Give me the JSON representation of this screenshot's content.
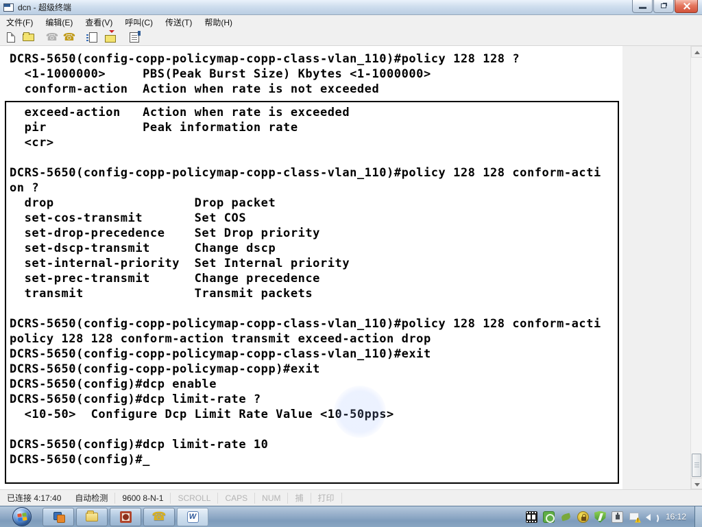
{
  "window": {
    "title": "dcn - 超级终端",
    "controls": {
      "minimize": "minimize",
      "restore": "restore",
      "close": "close"
    }
  },
  "menu": {
    "items": [
      {
        "label": "文件(F)"
      },
      {
        "label": "编辑(E)"
      },
      {
        "label": "查看(V)"
      },
      {
        "label": "呼叫(C)"
      },
      {
        "label": "传送(T)"
      },
      {
        "label": "帮助(H)"
      }
    ]
  },
  "toolbar": {
    "icons": [
      "new-connection",
      "open",
      "call",
      "hang-up",
      "send-file",
      "receive-file",
      "properties"
    ],
    "call_disabled": true
  },
  "terminal": {
    "scrollback_lines": [
      "DCRS-5650(config-copp-policymap-copp-class-vlan_110)#policy 128 128 ?",
      "  <1-1000000>     PBS(Peak Burst Size) Kbytes <1-1000000>",
      "  conform-action  Action when rate is not exceeded"
    ],
    "screen_lines": [
      "  exceed-action   Action when rate is exceeded",
      "  pir             Peak information rate",
      "  <cr>",
      "",
      "DCRS-5650(config-copp-policymap-copp-class-vlan_110)#policy 128 128 conform-acti",
      "on ?",
      "  drop                   Drop packet",
      "  set-cos-transmit       Set COS",
      "  set-drop-precedence    Set Drop priority",
      "  set-dscp-transmit      Change dscp",
      "  set-internal-priority  Set Internal priority",
      "  set-prec-transmit      Change precedence",
      "  transmit               Transmit packets",
      "",
      "DCRS-5650(config-copp-policymap-copp-class-vlan_110)#policy 128 128 conform-acti",
      "policy 128 128 conform-action transmit exceed-action drop",
      "DCRS-5650(config-copp-policymap-copp-class-vlan_110)#exit",
      "DCRS-5650(config-copp-policymap-copp)#exit",
      "DCRS-5650(config)#dcp enable",
      "DCRS-5650(config)#dcp limit-rate ?",
      "  <10-50>  Configure Dcp Limit Rate Value <10-50pps>",
      "",
      "DCRS-5650(config)#dcp limit-rate 10",
      "DCRS-5650(config)#_"
    ]
  },
  "status_bar": {
    "panes": [
      {
        "label": "已连接 4:17:40",
        "state": "normal"
      },
      {
        "label": "自动检测",
        "state": "normal"
      },
      {
        "label": "9600 8-N-1",
        "state": "normal"
      },
      {
        "label": "SCROLL",
        "state": "disabled"
      },
      {
        "label": "CAPS",
        "state": "disabled"
      },
      {
        "label": "NUM",
        "state": "disabled"
      },
      {
        "label": "捕",
        "state": "disabled"
      },
      {
        "label": "打印",
        "state": "disabled"
      }
    ]
  },
  "taskbar": {
    "buttons": [
      "vm-window-app",
      "windows-explorer",
      "screen-recorder-app",
      "hyperterminal",
      "microsoft-word"
    ],
    "word_glyph": "W",
    "tray_icons": [
      "film-strip",
      "screen-record",
      "graphics-leaf",
      "security-lock",
      "antivirus-shield",
      "safely-remove-device",
      "network-warning",
      "volume"
    ],
    "clock": "16:12"
  },
  "colors": {
    "titlebar": "#cfdeee",
    "close_button": "#d2523a",
    "terminal_bg": "#ffffff",
    "terminal_text": "#000000",
    "taskbar": "#8aa6c3",
    "chrome": "#f0f0f0"
  }
}
